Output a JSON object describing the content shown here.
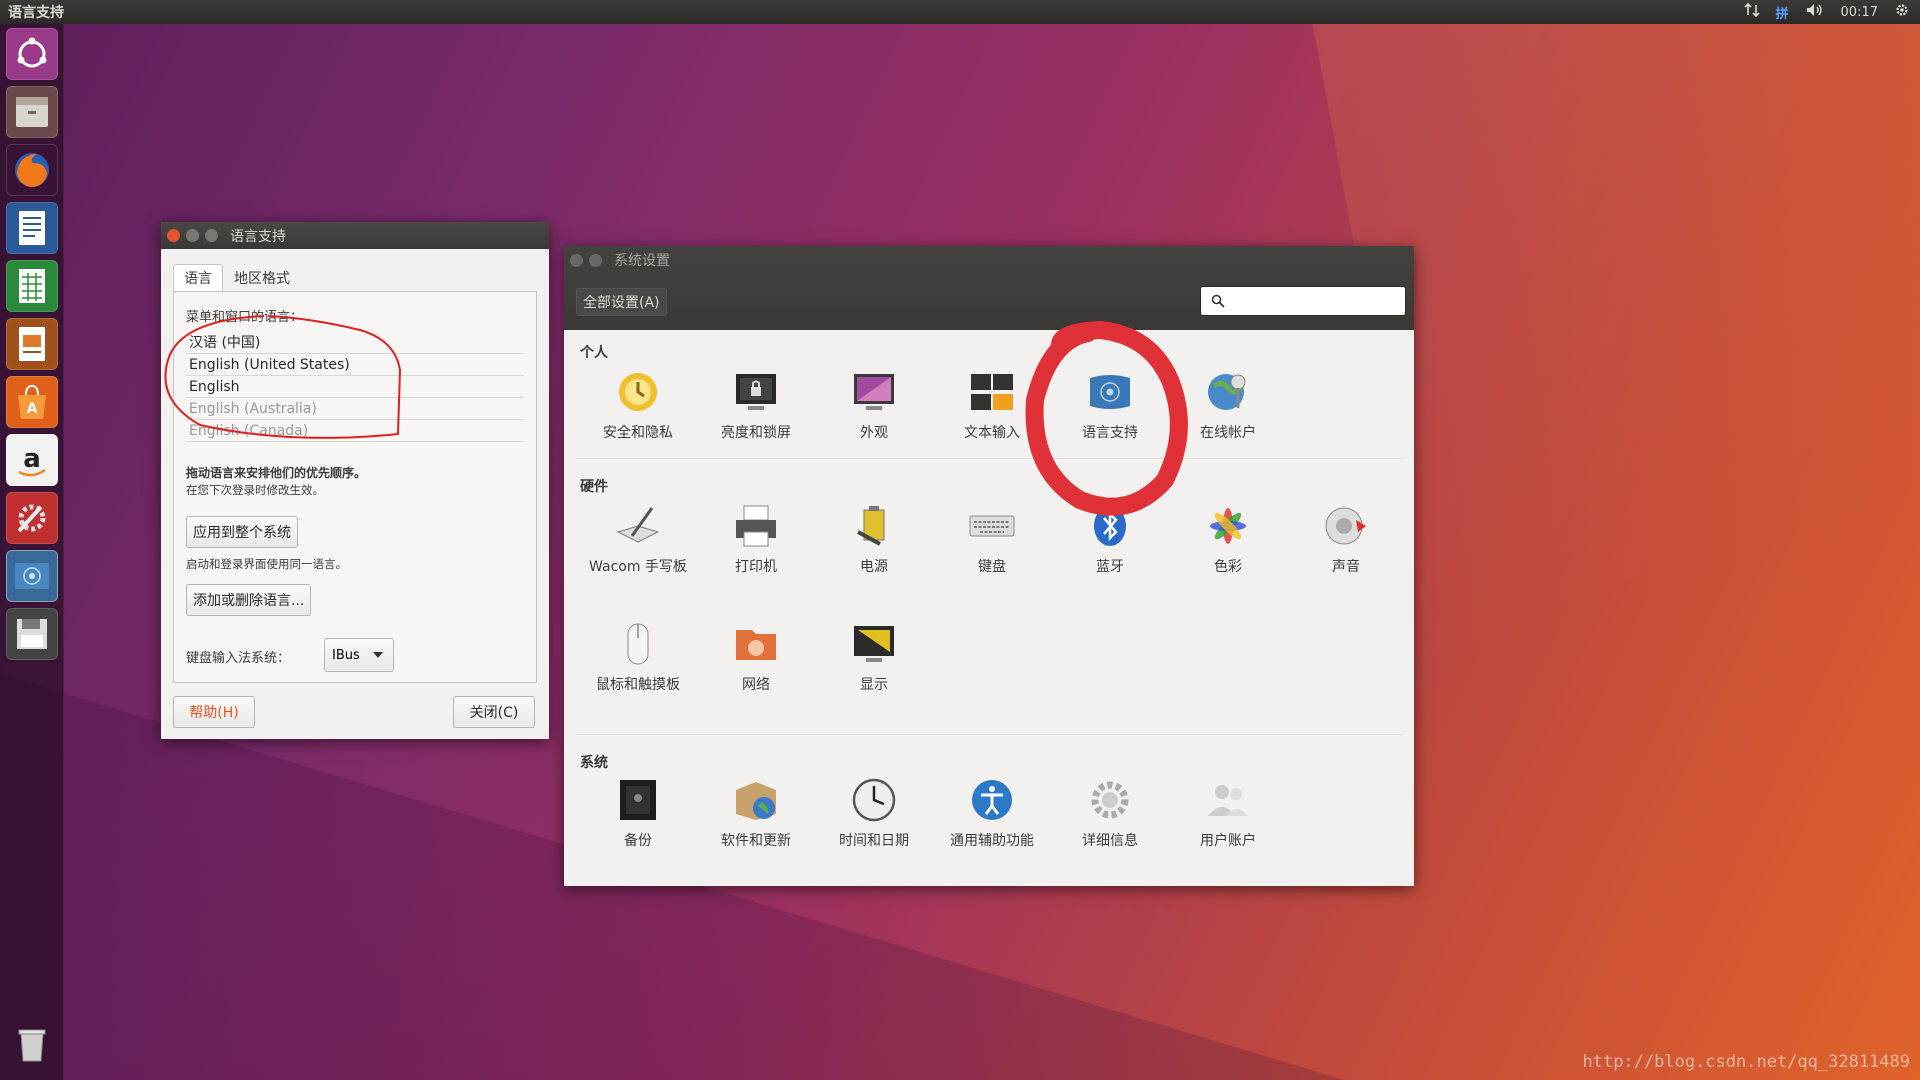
{
  "top_panel": {
    "title": "语言支持",
    "input_method": "拼",
    "time": "00:17"
  },
  "language_window": {
    "title": "语言支持",
    "tabs": [
      "语言",
      "地区格式"
    ],
    "menu_language_label": "菜单和窗口的语言：",
    "languages": [
      "汉语 (中国)",
      "English (United States)",
      "English",
      "English (Australia)",
      "English (Canada)"
    ],
    "drag_hint": "拖动语言来安排他们的优先顺序。",
    "relogin_hint": "在您下次登录时修改生效。",
    "apply_button": "应用到整个系统",
    "login_hint": "启动和登录界面使用同一语言。",
    "add_remove_button": "添加或删除语言...",
    "input_method_label": "键盘输入法系统：",
    "input_method_value": "IBus",
    "help_button": "帮助(H)",
    "close_button": "关闭(C)"
  },
  "system_settings": {
    "title": "系统设置",
    "all_settings_button": "全部设置(A)",
    "search_placeholder": "",
    "sections": {
      "personal": {
        "title": "个人",
        "items": [
          "安全和隐私",
          "亮度和锁屏",
          "外观",
          "文本输入",
          "语言支持",
          "在线帐户"
        ]
      },
      "hardware": {
        "title": "硬件",
        "items": [
          "Wacom 手写板",
          "打印机",
          "电源",
          "键盘",
          "蓝牙",
          "色彩",
          "声音",
          "鼠标和触摸板",
          "网络",
          "显示"
        ]
      },
      "system": {
        "title": "系统",
        "items": [
          "备份",
          "软件和更新",
          "时间和日期",
          "通用辅助功能",
          "详细信息",
          "用户账户"
        ]
      }
    }
  },
  "watermark": "http://blog.csdn.net/qq_32811489",
  "colors": {
    "annotation_red": "#e02020",
    "ubuntu_orange": "#e95420",
    "help_text": "#e95420"
  }
}
